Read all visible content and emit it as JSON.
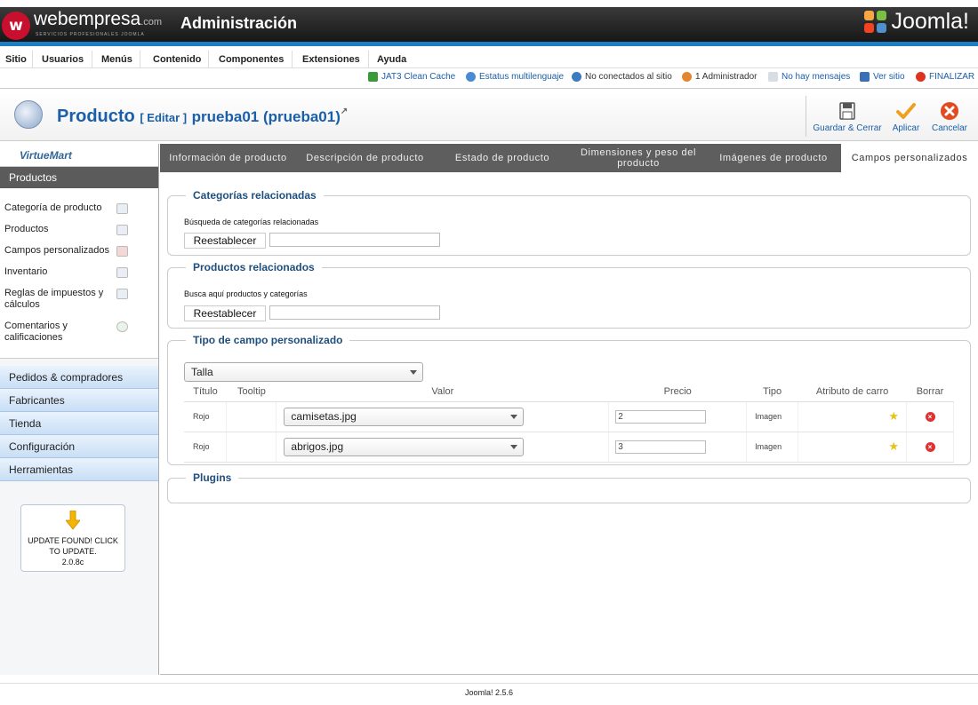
{
  "header": {
    "brand_name": "webempresa",
    "brand_suffix": ".com",
    "brand_tagline": "SERVICIOS PROFESIONALES JOOMLA",
    "title": "Administración",
    "joomla_logo": "Joomla!"
  },
  "menu": {
    "items": [
      "Sitio",
      "Usuarios",
      "Menús",
      "Contenido",
      "Componentes",
      "Extensiones",
      "Ayuda"
    ]
  },
  "status": {
    "cache": "JAT3 Clean Cache",
    "multilang": "Estatus multilenguaje",
    "not_connected": "No conectados al sitio",
    "admins": "1 Administrador",
    "messages": "No hay mensajes",
    "view_site": "Ver sitio",
    "logout": "FINALIZAR"
  },
  "toolbar": {
    "title": "Producto",
    "edit_tag": "[ Editar ]",
    "item_name": "prueba01 (prueba01)",
    "save_close": "Guardar & Cerrar",
    "apply": "Aplicar",
    "cancel": "Cancelar"
  },
  "sidebar": {
    "logo": "VirtueMart",
    "header": "Productos",
    "items": [
      "Categoría de producto",
      "Productos",
      "Campos personalizados",
      "Inventario",
      "Reglas de impuestos y cálculos",
      "Comentarios y calificaciones"
    ],
    "sections": [
      "Pedidos & compradores",
      "Fabricantes",
      "Tienda",
      "Configuración",
      "Herramientas"
    ],
    "update_line1": "UPDATE FOUND! CLICK",
    "update_line2": "TO UPDATE.",
    "update_version": "2.0.8c"
  },
  "tabs": [
    "Información de producto",
    "Descripción de producto",
    "Estado de producto",
    "Dimensiones y peso del producto",
    "Imágenes de producto",
    "Campos personalizados"
  ],
  "related_categories": {
    "legend": "Categorías relacionadas",
    "label": "Búsqueda de categorías relacionadas",
    "button": "Reestablecer"
  },
  "related_products": {
    "legend": "Productos relacionados",
    "label": "Busca aquí productos y categorías",
    "button": "Reestablecer"
  },
  "custom_fields": {
    "legend": "Tipo de campo personalizado",
    "type_select": "Talla",
    "headers": [
      "Título",
      "Tooltip",
      "Valor",
      "Precio",
      "Tipo",
      "Atributo de carro",
      "Borrar"
    ],
    "rows": [
      {
        "title": "Rojo",
        "tooltip": "",
        "value": "camisetas.jpg",
        "price": "2",
        "type": "Imagen"
      },
      {
        "title": "Rojo",
        "tooltip": "",
        "value": "abrigos.jpg",
        "price": "3",
        "type": "Imagen"
      }
    ]
  },
  "plugins": {
    "legend": "Plugins"
  },
  "footer": "Joomla! 2.5.6",
  "colors": {
    "accent": "#1a5fa8",
    "header_dark": "#121212",
    "brand_bar": "#1c7fc4",
    "tab_bar": "#5e5e5e"
  }
}
